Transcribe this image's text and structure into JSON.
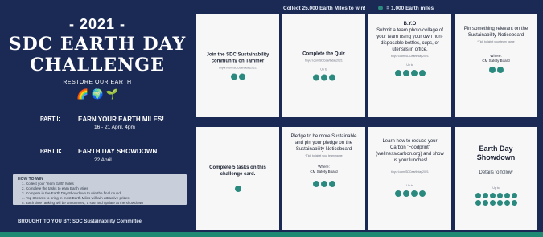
{
  "header": {
    "collected": "Collect 25,000 Earth Miles to win!",
    "legend": "= 1,000 Earth miles"
  },
  "left": {
    "year": "- 2021 -",
    "title_line1": "SDC EARTH DAY",
    "title_line2": "CHALLENGE",
    "subtitle": "RESTORE OUR EARTH",
    "emojis": "🌈 🌍 🌱",
    "part1_label": "PART I:",
    "part1_title": "EARN YOUR EARTH MILES!",
    "part1_date": "16 - 21 April, 4pm",
    "part2_label": "PART II:",
    "part2_title": "EARTH DAY SHOWDOWN",
    "part2_date": "22 April",
    "howto": {
      "title": "HOW TO WIN",
      "steps": [
        "Collect your Team Earth Miles",
        "Complete the tasks to earn Earth Miles",
        "Compete in the Earth Day Showdown to win the final round",
        "Top 3 teams to bring in most Earth Miles will win attractive prizes",
        "Each time ranking will be announced, a star and update at the showdown"
      ]
    },
    "footer": "BROUGHT TO YOU BY: SDC Sustainability Committee"
  },
  "cards": [
    {
      "id": "tammer",
      "main": "Join the SDC Sustainability community on Tammer",
      "sub": "tinyurl.com/SDCearthday2021",
      "upto": "",
      "where": "",
      "dots": 2
    },
    {
      "id": "quiz",
      "main": "Complete the Quiz",
      "sub": "tinyurl.com/SDCearthday2021",
      "upto": "Up to",
      "where": "",
      "dots": 3
    },
    {
      "id": "byo",
      "main": "B.Y.O",
      "main2": "Submit a team photo/collage of your team using your own non-disposable bottles, cups, or utensils in office.",
      "sub": "tinyurl.com/SDCearthday2021",
      "upto": "Up to",
      "where": "",
      "dots": 4
    },
    {
      "id": "noticeboard",
      "main": "Pin something relevant on the Sustainability Noticeboard",
      "sub": "*Tick to label your team name",
      "upto": "",
      "where_label": "Where:",
      "where": "CM Safety Board",
      "dots": 2
    },
    {
      "id": "complete5",
      "main": "Complete 5 tasks on this challenge card.",
      "sub": "",
      "upto": "",
      "where": "",
      "dots": 1
    },
    {
      "id": "pledge",
      "main": "Pledge to be more Sustainable and pin your pledge on the Sustainability Noticeboard",
      "sub": "*Tick to label your team name",
      "upto": "",
      "where_label": "Where:",
      "where": "CM Safety Board",
      "dots": 3
    },
    {
      "id": "footprint",
      "main": "Learn how to reduce your Carbon 'Foodprint' (wellness/carbon.org) and show us your lunches!",
      "sub": "tinyurl.com/SDCearthday2021",
      "upto": "Up to",
      "where": "",
      "dots": 4
    },
    {
      "id": "showdown",
      "main": "Earth Day Showdown",
      "details": "Details to follow",
      "upto": "Up to",
      "dots": 12
    }
  ],
  "colors": {
    "navy": "#1b2a55",
    "teal_dot": "#2b8a7f",
    "card_bg": "#f7f7f7",
    "teal_bar": "#1e8a73"
  }
}
